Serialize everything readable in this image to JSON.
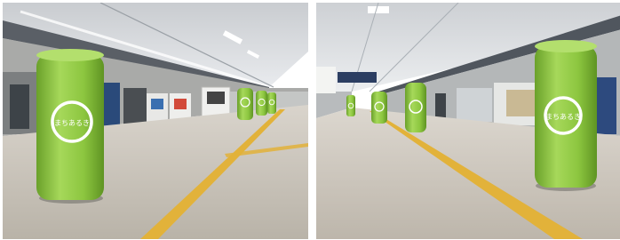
{
  "photos": [
    {
      "id": "left",
      "subject": "concourse-with-green-pillar-ads"
    },
    {
      "id": "right",
      "subject": "concourse-with-green-pillar-ads"
    }
  ],
  "pillar_logo_text": "まちあるき",
  "colors": {
    "pillar_green": "#8cc63f",
    "pillar_green_dark": "#6aa12a",
    "floor_line_yellow": "#e2b23a",
    "floor": "#cfcac0",
    "ceiling": "#dcdfe3"
  }
}
